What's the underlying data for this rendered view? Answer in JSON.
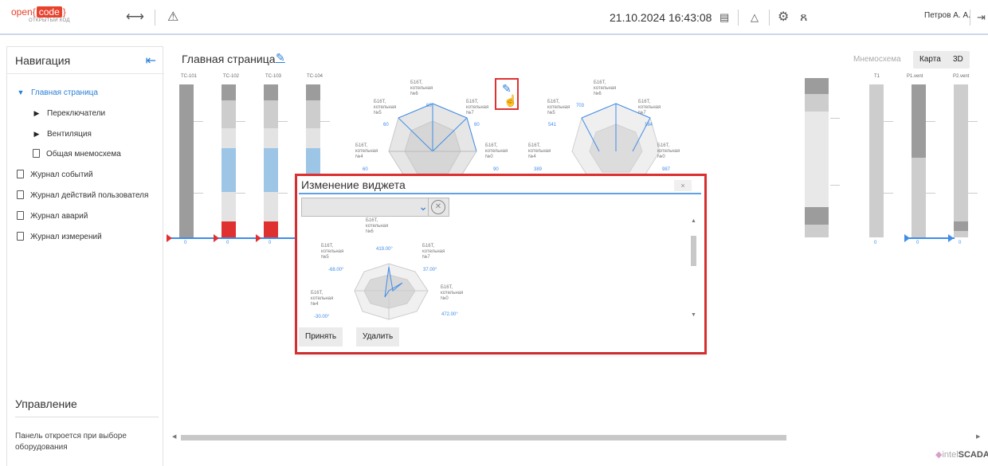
{
  "topbar": {
    "logo_prefix": "open",
    "logo_code": "code",
    "logo_sub": "ОТКРЫТЫЙ КОД",
    "datetime": "21.10.2024 16:43:08",
    "user": "Петров А. А."
  },
  "sidebar": {
    "title": "Навигация",
    "items": [
      {
        "label": "Главная страница"
      },
      {
        "label": "Переключатели"
      },
      {
        "label": "Вентиляция"
      },
      {
        "label": "Общая мнемосхема"
      },
      {
        "label": "Журнал событий"
      },
      {
        "label": "Журнал действий пользователя"
      },
      {
        "label": "Журнал аварий"
      },
      {
        "label": "Журнал измерений"
      }
    ],
    "management_title": "Управление",
    "management_text": "Панель откроется при выборе оборудования"
  },
  "main": {
    "title": "Главная страница",
    "tabs": [
      "Мнемосхема",
      "Карта",
      "3D"
    ],
    "tc_labels": [
      "TC-101",
      "TC-102",
      "TC-103",
      "TC-104"
    ],
    "right_labels": [
      "T1",
      "P1.vent",
      "P2.vent"
    ],
    "zero": "0",
    "radar1": {
      "labels": [
        "Б16Т,\nкотельная\n№6",
        "Б16Т,\nкотельная\n№5",
        "Б16Т,\nкотельная\n№7",
        "Б16Т,\nкотельная\n№4",
        "Б16Т,\nкотельная\n№0"
      ],
      "values": [
        "60",
        "60",
        "60",
        "60",
        "90"
      ]
    },
    "radar2": {
      "labels": [
        "Б16Т,\nкотельная\n№6",
        "Б16Т,\nкотельная\n№5",
        "Б16Т,\nкотельная\n№7",
        "Б16Т,\nкотельная\n№4",
        "Б16Т,\nкотельная\n№0"
      ],
      "values": [
        "703",
        "541",
        "184",
        "389",
        "987"
      ]
    },
    "brand_prefix": "intel",
    "brand_name": "SCADA"
  },
  "modal": {
    "title": "Изменение виджета",
    "close": "×",
    "radar": {
      "labels": [
        "Б16Т,\nкотельная\n№6",
        "Б16Т,\nкотельная\n№5",
        "Б16Т,\nкотельная\n№7",
        "Б16Т,\nкотельная\n№4",
        "Б16Т,\nкотельная\n№0"
      ],
      "values": [
        "419.00°",
        "-68.00°",
        "37.00°",
        "-30.00°",
        "472.00°"
      ]
    },
    "accept": "Принять",
    "delete": "Удалить"
  }
}
